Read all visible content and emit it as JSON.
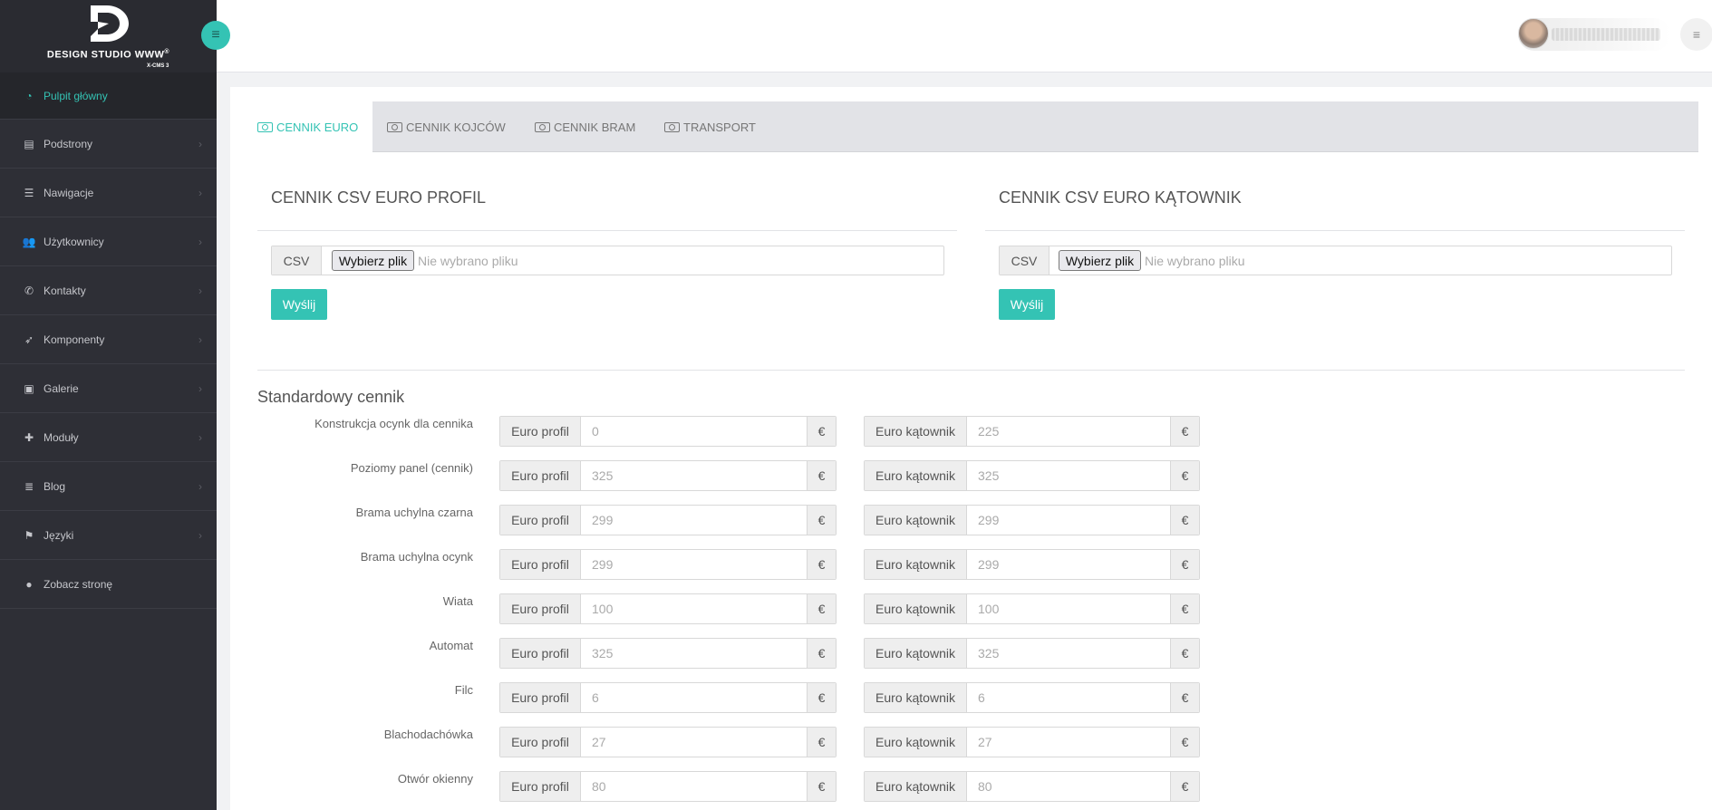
{
  "brand": {
    "name": "DESIGN STUDIO WWW",
    "trademark": "®",
    "subtitle": "X-CMS 3"
  },
  "sidebar": {
    "items": [
      {
        "label": "Pulpit główny",
        "icon": "dashboard-icon",
        "active": true
      },
      {
        "label": "Podstrony",
        "icon": "file-icon"
      },
      {
        "label": "Nawigacje",
        "icon": "list-icon"
      },
      {
        "label": "Użytkownicy",
        "icon": "users-icon"
      },
      {
        "label": "Kontakty",
        "icon": "phone-icon"
      },
      {
        "label": "Komponenty",
        "icon": "rocket-icon"
      },
      {
        "label": "Galerie",
        "icon": "image-icon"
      },
      {
        "label": "Moduły",
        "icon": "puzzle-icon"
      },
      {
        "label": "Blog",
        "icon": "blog-icon"
      },
      {
        "label": "Języki",
        "icon": "flag-icon"
      },
      {
        "label": "Zobacz stronę",
        "icon": "globe-icon"
      }
    ]
  },
  "tabs": [
    {
      "label": "CENNIK EURO",
      "active": true
    },
    {
      "label": "CENNIK KOJCÓW"
    },
    {
      "label": "CENNIK BRAM"
    },
    {
      "label": "TRANSPORT"
    }
  ],
  "csv_left": {
    "title": "CENNIK CSV EURO PROFIL",
    "addon": "CSV",
    "file_button": "Wybierz plik",
    "file_status": "Nie wybrano pliku",
    "submit": "Wyślij"
  },
  "csv_right": {
    "title": "CENNIK CSV EURO KĄTOWNIK",
    "addon": "CSV",
    "file_button": "Wybierz plik",
    "file_status": "Nie wybrano pliku",
    "submit": "Wyślij"
  },
  "standard": {
    "title": "Standardowy cennik",
    "profil_label": "Euro profil",
    "katownik_label": "Euro kątownik",
    "currency": "€",
    "rows": [
      {
        "label": "Konstrukcja ocynk dla cennika",
        "profil": "0",
        "katownik": "225"
      },
      {
        "label": "Poziomy panel (cennik)",
        "profil": "325",
        "katownik": "325"
      },
      {
        "label": "Brama uchylna czarna",
        "profil": "299",
        "katownik": "299"
      },
      {
        "label": "Brama uchylna ocynk",
        "profil": "299",
        "katownik": "299"
      },
      {
        "label": "Wiata",
        "profil": "100",
        "katownik": "100"
      },
      {
        "label": "Automat",
        "profil": "325",
        "katownik": "325"
      },
      {
        "label": "Filc",
        "profil": "6",
        "katownik": "6"
      },
      {
        "label": "Blachodachówka",
        "profil": "27",
        "katownik": "27"
      },
      {
        "label": "Otwór okienny",
        "profil": "80",
        "katownik": "80"
      }
    ]
  },
  "colors": {
    "accent": "#34c3b4",
    "sidebar": "#2e2f36"
  }
}
